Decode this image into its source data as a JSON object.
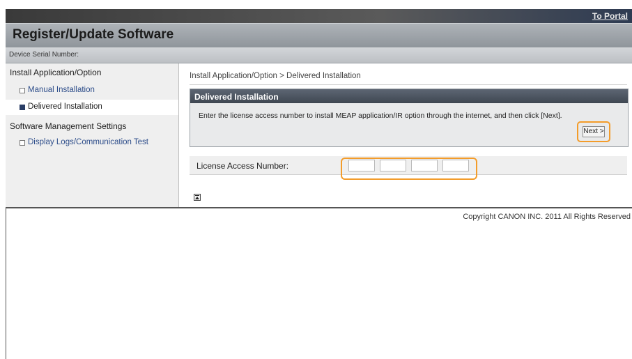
{
  "header": {
    "portal_link": "To Portal",
    "title": "Register/Update Software",
    "serial_label": "Device Serial Number:"
  },
  "sidebar": {
    "group1": "Install Application/Option",
    "items1": [
      {
        "label": "Manual Installation",
        "selected": false
      },
      {
        "label": "Delivered Installation",
        "selected": true
      }
    ],
    "group2": "Software Management Settings",
    "items2": [
      {
        "label": "Display Logs/Communication Test",
        "selected": false
      }
    ]
  },
  "main": {
    "breadcrumb": "Install Application/Option > Delivered Installation",
    "panel_title": "Delivered Installation",
    "panel_desc": "Enter the license access number to install MEAP application/IR option through the internet, and then click [Next].",
    "next_label": "Next >",
    "license_label": "License Access Number:",
    "license_fields": [
      "",
      "",
      "",
      ""
    ]
  },
  "footer": {
    "copyright": "Copyright CANON INC. 2011 All Rights Reserved"
  },
  "colors": {
    "highlight": "#f39c2a",
    "panel_header": "#4a5260",
    "link": "#2d4d8a"
  },
  "icons": {
    "page_top": "page-top-icon"
  }
}
